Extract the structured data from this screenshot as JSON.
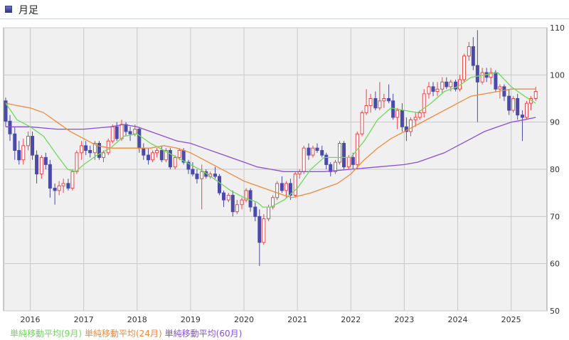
{
  "header": {
    "title": "月足",
    "icon": "chart-icon"
  },
  "colors": {
    "up": "#e8474a",
    "down": "#4a4aa8",
    "ma9": "#6fd85c",
    "ma24": "#f08a3c",
    "ma60": "#8a4fd8",
    "grid": "#c8c8c8",
    "plot_bg": "#f0f0f0"
  },
  "chart_data": {
    "type": "candlestick",
    "x_ticks": [
      "2016",
      "2017",
      "2018",
      "2019",
      "2020",
      "2021",
      "2022",
      "2023",
      "2024",
      "2025"
    ],
    "y_ticks": [
      "110",
      "100",
      "90",
      "80",
      "70",
      "60",
      "50"
    ],
    "ylim": [
      50,
      110
    ],
    "xlim": [
      2015.5,
      2025.67
    ],
    "y_axis_side": "right",
    "legend_position": "bottom-left",
    "grid": true,
    "legend": [
      {
        "name": "単純移動平均(9月)",
        "color": "#6fd85c"
      },
      {
        "name": "単純移動平均(24月)",
        "color": "#f08a3c"
      },
      {
        "name": "単純移動平均(60月)",
        "color": "#8a4fd8"
      }
    ],
    "candles": [
      [
        2015.54,
        94.5,
        95.2,
        89.0,
        90.2
      ],
      [
        2015.62,
        90.2,
        91.5,
        86.0,
        87.5
      ],
      [
        2015.71,
        87.5,
        89.0,
        82.0,
        84.0
      ],
      [
        2015.79,
        84.0,
        86.0,
        81.0,
        82.0
      ],
      [
        2015.87,
        82.0,
        86.5,
        81.0,
        85.0
      ],
      [
        2015.96,
        85.0,
        88.0,
        84.0,
        87.0
      ],
      [
        2016.04,
        87.0,
        88.0,
        82.0,
        83.0
      ],
      [
        2016.12,
        83.0,
        84.0,
        77.0,
        79.0
      ],
      [
        2016.21,
        79.0,
        83.0,
        78.0,
        82.5
      ],
      [
        2016.29,
        82.5,
        83.5,
        80.0,
        81.0
      ],
      [
        2016.37,
        81.0,
        82.0,
        74.0,
        76.0
      ],
      [
        2016.46,
        76.0,
        77.0,
        72.5,
        75.5
      ],
      [
        2016.54,
        75.5,
        77.5,
        74.5,
        76.5
      ],
      [
        2016.62,
        76.5,
        78.0,
        75.0,
        77.0
      ],
      [
        2016.71,
        77.0,
        78.0,
        75.5,
        76.0
      ],
      [
        2016.79,
        76.0,
        80.0,
        75.5,
        79.5
      ],
      [
        2016.87,
        79.5,
        84.0,
        79.0,
        83.5
      ],
      [
        2016.96,
        83.5,
        86.0,
        82.0,
        85.0
      ],
      [
        2017.04,
        85.0,
        86.0,
        83.0,
        84.0
      ],
      [
        2017.12,
        84.0,
        85.0,
        82.5,
        83.5
      ],
      [
        2017.21,
        83.5,
        86.0,
        82.0,
        85.5
      ],
      [
        2017.29,
        85.5,
        86.0,
        82.0,
        82.5
      ],
      [
        2017.37,
        82.5,
        84.0,
        81.5,
        83.5
      ],
      [
        2017.46,
        83.5,
        86.5,
        83.0,
        86.0
      ],
      [
        2017.54,
        86.0,
        89.5,
        85.5,
        89.0
      ],
      [
        2017.62,
        89.0,
        90.0,
        86.0,
        86.5
      ],
      [
        2017.71,
        86.5,
        90.5,
        86.0,
        89.5
      ],
      [
        2017.79,
        89.5,
        90.0,
        87.0,
        88.0
      ],
      [
        2017.87,
        88.0,
        89.0,
        86.0,
        87.5
      ],
      [
        2017.96,
        87.5,
        89.5,
        87.0,
        88.5
      ],
      [
        2018.04,
        88.5,
        89.0,
        83.5,
        84.5
      ],
      [
        2018.12,
        84.5,
        85.5,
        82.0,
        83.0
      ],
      [
        2018.21,
        83.0,
        84.5,
        81.0,
        82.0
      ],
      [
        2018.29,
        82.0,
        84.0,
        81.5,
        83.5
      ],
      [
        2018.37,
        83.5,
        84.5,
        82.5,
        84.0
      ],
      [
        2018.46,
        84.0,
        85.0,
        81.5,
        82.0
      ],
      [
        2018.54,
        82.0,
        84.5,
        81.5,
        84.0
      ],
      [
        2018.62,
        84.0,
        84.5,
        80.0,
        80.5
      ],
      [
        2018.71,
        80.5,
        83.0,
        80.0,
        82.5
      ],
      [
        2018.79,
        82.5,
        84.5,
        82.0,
        84.0
      ],
      [
        2018.87,
        84.0,
        84.5,
        81.0,
        81.5
      ],
      [
        2018.96,
        81.5,
        82.0,
        79.0,
        80.0
      ],
      [
        2019.04,
        80.0,
        81.5,
        78.5,
        79.0
      ],
      [
        2019.12,
        79.0,
        80.0,
        77.0,
        78.0
      ],
      [
        2019.21,
        78.0,
        81.0,
        71.5,
        79.5
      ],
      [
        2019.29,
        79.5,
        80.0,
        78.0,
        78.5
      ],
      [
        2019.37,
        78.5,
        79.5,
        78.0,
        79.0
      ],
      [
        2019.46,
        79.0,
        80.5,
        78.0,
        78.5
      ],
      [
        2019.54,
        78.5,
        79.0,
        74.5,
        75.0
      ],
      [
        2019.62,
        75.0,
        75.5,
        72.0,
        73.5
      ],
      [
        2019.71,
        73.5,
        75.0,
        73.0,
        74.5
      ],
      [
        2019.79,
        74.5,
        75.5,
        70.0,
        71.0
      ],
      [
        2019.87,
        71.0,
        73.5,
        70.5,
        72.5
      ],
      [
        2019.96,
        72.5,
        74.0,
        71.5,
        73.5
      ],
      [
        2020.04,
        73.5,
        76.0,
        73.0,
        75.5
      ],
      [
        2020.12,
        75.5,
        76.0,
        71.0,
        72.0
      ],
      [
        2020.21,
        72.0,
        73.0,
        69.0,
        70.0
      ],
      [
        2020.29,
        70.0,
        71.5,
        59.5,
        64.5
      ],
      [
        2020.37,
        64.5,
        70.5,
        64.0,
        69.5
      ],
      [
        2020.46,
        69.5,
        72.5,
        69.0,
        72.0
      ],
      [
        2020.54,
        72.0,
        74.5,
        71.5,
        74.0
      ],
      [
        2020.62,
        74.0,
        77.5,
        73.5,
        77.0
      ],
      [
        2020.71,
        77.0,
        78.5,
        75.0,
        75.5
      ],
      [
        2020.79,
        75.5,
        77.5,
        74.0,
        77.0
      ],
      [
        2020.87,
        77.0,
        78.0,
        73.5,
        74.5
      ],
      [
        2020.96,
        74.5,
        79.5,
        74.0,
        79.0
      ],
      [
        2021.04,
        79.0,
        80.0,
        78.0,
        79.5
      ],
      [
        2021.12,
        79.5,
        85.0,
        79.0,
        84.5
      ],
      [
        2021.21,
        84.5,
        85.5,
        82.0,
        83.0
      ],
      [
        2021.29,
        83.0,
        85.0,
        82.5,
        84.5
      ],
      [
        2021.37,
        84.5,
        85.5,
        83.5,
        84.0
      ],
      [
        2021.46,
        84.0,
        85.0,
        82.5,
        83.0
      ],
      [
        2021.54,
        83.0,
        83.5,
        80.0,
        81.0
      ],
      [
        2021.62,
        81.0,
        81.5,
        78.5,
        79.5
      ],
      [
        2021.71,
        79.5,
        82.0,
        79.0,
        81.5
      ],
      [
        2021.79,
        81.5,
        86.0,
        81.0,
        85.5
      ],
      [
        2021.87,
        85.5,
        86.0,
        80.0,
        80.5
      ],
      [
        2021.96,
        80.5,
        83.0,
        80.0,
        82.5
      ],
      [
        2022.04,
        82.5,
        83.5,
        80.0,
        81.0
      ],
      [
        2022.12,
        81.0,
        88.0,
        80.0,
        87.5
      ],
      [
        2022.21,
        87.5,
        92.5,
        87.0,
        92.0
      ],
      [
        2022.29,
        92.0,
        97.0,
        91.5,
        93.5
      ],
      [
        2022.37,
        93.5,
        96.0,
        92.0,
        95.0
      ],
      [
        2022.46,
        95.0,
        96.5,
        92.5,
        93.0
      ],
      [
        2022.54,
        93.0,
        98.5,
        92.5,
        94.5
      ],
      [
        2022.62,
        94.5,
        96.0,
        93.0,
        95.0
      ],
      [
        2022.71,
        95.0,
        98.0,
        94.0,
        94.5
      ],
      [
        2022.79,
        94.5,
        96.0,
        90.5,
        91.0
      ],
      [
        2022.87,
        91.0,
        93.0,
        88.5,
        92.5
      ],
      [
        2022.96,
        92.5,
        94.0,
        88.0,
        89.0
      ],
      [
        2023.04,
        89.0,
        91.0,
        86.0,
        88.0
      ],
      [
        2023.12,
        88.0,
        91.0,
        87.0,
        90.5
      ],
      [
        2023.21,
        90.5,
        92.0,
        89.0,
        91.0
      ],
      [
        2023.29,
        91.0,
        92.5,
        90.5,
        92.0
      ],
      [
        2023.37,
        92.0,
        97.0,
        91.0,
        96.0
      ],
      [
        2023.46,
        96.0,
        98.5,
        95.0,
        97.5
      ],
      [
        2023.54,
        97.5,
        98.5,
        95.5,
        96.5
      ],
      [
        2023.62,
        96.5,
        98.5,
        95.5,
        97.0
      ],
      [
        2023.71,
        97.0,
        99.5,
        96.0,
        98.5
      ],
      [
        2023.79,
        98.5,
        99.5,
        97.0,
        97.5
      ],
      [
        2023.87,
        97.5,
        99.0,
        96.5,
        98.5
      ],
      [
        2023.96,
        98.5,
        99.0,
        96.5,
        97.0
      ],
      [
        2024.04,
        97.0,
        100.0,
        96.5,
        99.0
      ],
      [
        2024.12,
        99.0,
        104.5,
        98.5,
        104.0
      ],
      [
        2024.21,
        104.0,
        107.0,
        103.0,
        106.0
      ],
      [
        2024.29,
        106.0,
        108.0,
        101.0,
        102.0
      ],
      [
        2024.37,
        102.0,
        109.5,
        90.0,
        98.5
      ],
      [
        2024.46,
        98.5,
        101.5,
        98.0,
        100.5
      ],
      [
        2024.54,
        100.5,
        101.5,
        98.5,
        99.5
      ],
      [
        2024.62,
        99.5,
        101.5,
        98.0,
        100.5
      ],
      [
        2024.71,
        100.5,
        101.0,
        96.5,
        97.0
      ],
      [
        2024.79,
        97.0,
        98.0,
        95.0,
        97.5
      ],
      [
        2024.87,
        97.5,
        98.0,
        94.5,
        95.5
      ],
      [
        2024.96,
        95.5,
        97.0,
        91.5,
        92.5
      ],
      [
        2025.04,
        92.5,
        95.5,
        92.0,
        95.0
      ],
      [
        2025.12,
        95.0,
        96.0,
        90.5,
        91.5
      ],
      [
        2025.21,
        91.5,
        92.5,
        86.0,
        91.0
      ],
      [
        2025.29,
        91.0,
        94.5,
        90.5,
        94.0
      ],
      [
        2025.37,
        94.0,
        95.5,
        92.5,
        95.0
      ],
      [
        2025.46,
        95.0,
        97.5,
        94.5,
        96.5
      ]
    ],
    "ma9": [
      [
        2015.54,
        94.0
      ],
      [
        2015.75,
        90.5
      ],
      [
        2016.0,
        89.0
      ],
      [
        2016.25,
        87.0
      ],
      [
        2016.5,
        83.0
      ],
      [
        2016.7,
        80.0
      ],
      [
        2016.85,
        79.5
      ],
      [
        2017.0,
        81.0
      ],
      [
        2017.25,
        83.0
      ],
      [
        2017.5,
        84.5
      ],
      [
        2017.75,
        87.0
      ],
      [
        2018.0,
        87.5
      ],
      [
        2018.25,
        85.5
      ],
      [
        2018.5,
        84.0
      ],
      [
        2018.75,
        82.5
      ],
      [
        2019.0,
        81.0
      ],
      [
        2019.25,
        79.5
      ],
      [
        2019.5,
        77.5
      ],
      [
        2019.75,
        75.5
      ],
      [
        2020.0,
        74.0
      ],
      [
        2020.25,
        73.0
      ],
      [
        2020.35,
        72.0
      ],
      [
        2020.5,
        72.0
      ],
      [
        2020.75,
        73.5
      ],
      [
        2021.0,
        76.0
      ],
      [
        2021.25,
        80.0
      ],
      [
        2021.5,
        82.5
      ],
      [
        2021.75,
        82.5
      ],
      [
        2022.0,
        82.5
      ],
      [
        2022.25,
        86.0
      ],
      [
        2022.5,
        90.5
      ],
      [
        2022.75,
        93.0
      ],
      [
        2023.0,
        92.5
      ],
      [
        2023.25,
        92.0
      ],
      [
        2023.5,
        94.0
      ],
      [
        2023.75,
        96.5
      ],
      [
        2024.0,
        97.5
      ],
      [
        2024.25,
        99.5
      ],
      [
        2024.5,
        100.0
      ],
      [
        2024.75,
        100.5
      ],
      [
        2025.0,
        97.5
      ],
      [
        2025.25,
        95.5
      ],
      [
        2025.46,
        94.0
      ]
    ],
    "ma24": [
      [
        2015.54,
        94.0
      ],
      [
        2015.75,
        93.5
      ],
      [
        2016.0,
        93.0
      ],
      [
        2016.25,
        92.0
      ],
      [
        2016.5,
        90.0
      ],
      [
        2016.75,
        88.0
      ],
      [
        2017.0,
        86.5
      ],
      [
        2017.25,
        85.0
      ],
      [
        2017.5,
        84.5
      ],
      [
        2017.75,
        84.5
      ],
      [
        2018.0,
        84.5
      ],
      [
        2018.25,
        84.5
      ],
      [
        2018.5,
        85.0
      ],
      [
        2018.75,
        84.5
      ],
      [
        2019.0,
        83.5
      ],
      [
        2019.25,
        82.0
      ],
      [
        2019.5,
        80.5
      ],
      [
        2019.75,
        79.0
      ],
      [
        2020.0,
        77.5
      ],
      [
        2020.25,
        76.5
      ],
      [
        2020.5,
        75.5
      ],
      [
        2020.75,
        74.5
      ],
      [
        2020.9,
        74.0
      ],
      [
        2021.25,
        75.0
      ],
      [
        2021.5,
        76.0
      ],
      [
        2021.75,
        77.0
      ],
      [
        2022.0,
        79.0
      ],
      [
        2022.25,
        82.0
      ],
      [
        2022.5,
        84.5
      ],
      [
        2022.75,
        86.5
      ],
      [
        2023.0,
        88.0
      ],
      [
        2023.25,
        89.5
      ],
      [
        2023.5,
        91.0
      ],
      [
        2023.75,
        92.5
      ],
      [
        2024.0,
        94.0
      ],
      [
        2024.25,
        95.5
      ],
      [
        2024.5,
        96.0
      ],
      [
        2024.75,
        96.5
      ],
      [
        2025.0,
        97.0
      ],
      [
        2025.25,
        97.0
      ],
      [
        2025.46,
        97.0
      ]
    ],
    "ma60": [
      [
        2015.54,
        89.0
      ],
      [
        2016.0,
        89.0
      ],
      [
        2016.5,
        88.5
      ],
      [
        2017.0,
        88.5
      ],
      [
        2017.5,
        89.0
      ],
      [
        2017.75,
        89.5
      ],
      [
        2018.0,
        89.0
      ],
      [
        2018.25,
        88.0
      ],
      [
        2018.5,
        87.0
      ],
      [
        2018.75,
        86.0
      ],
      [
        2019.0,
        85.5
      ],
      [
        2019.25,
        84.5
      ],
      [
        2019.5,
        83.5
      ],
      [
        2019.75,
        82.5
      ],
      [
        2020.0,
        81.5
      ],
      [
        2020.25,
        80.5
      ],
      [
        2020.5,
        80.0
      ],
      [
        2020.75,
        79.5
      ],
      [
        2021.0,
        79.5
      ],
      [
        2021.5,
        79.5
      ],
      [
        2022.0,
        80.0
      ],
      [
        2022.5,
        80.5
      ],
      [
        2023.0,
        81.0
      ],
      [
        2023.25,
        81.5
      ],
      [
        2023.5,
        82.5
      ],
      [
        2023.75,
        83.5
      ],
      [
        2024.0,
        85.0
      ],
      [
        2024.25,
        86.5
      ],
      [
        2024.5,
        88.0
      ],
      [
        2024.75,
        89.0
      ],
      [
        2025.0,
        90.0
      ],
      [
        2025.25,
        90.5
      ],
      [
        2025.46,
        91.0
      ]
    ]
  }
}
